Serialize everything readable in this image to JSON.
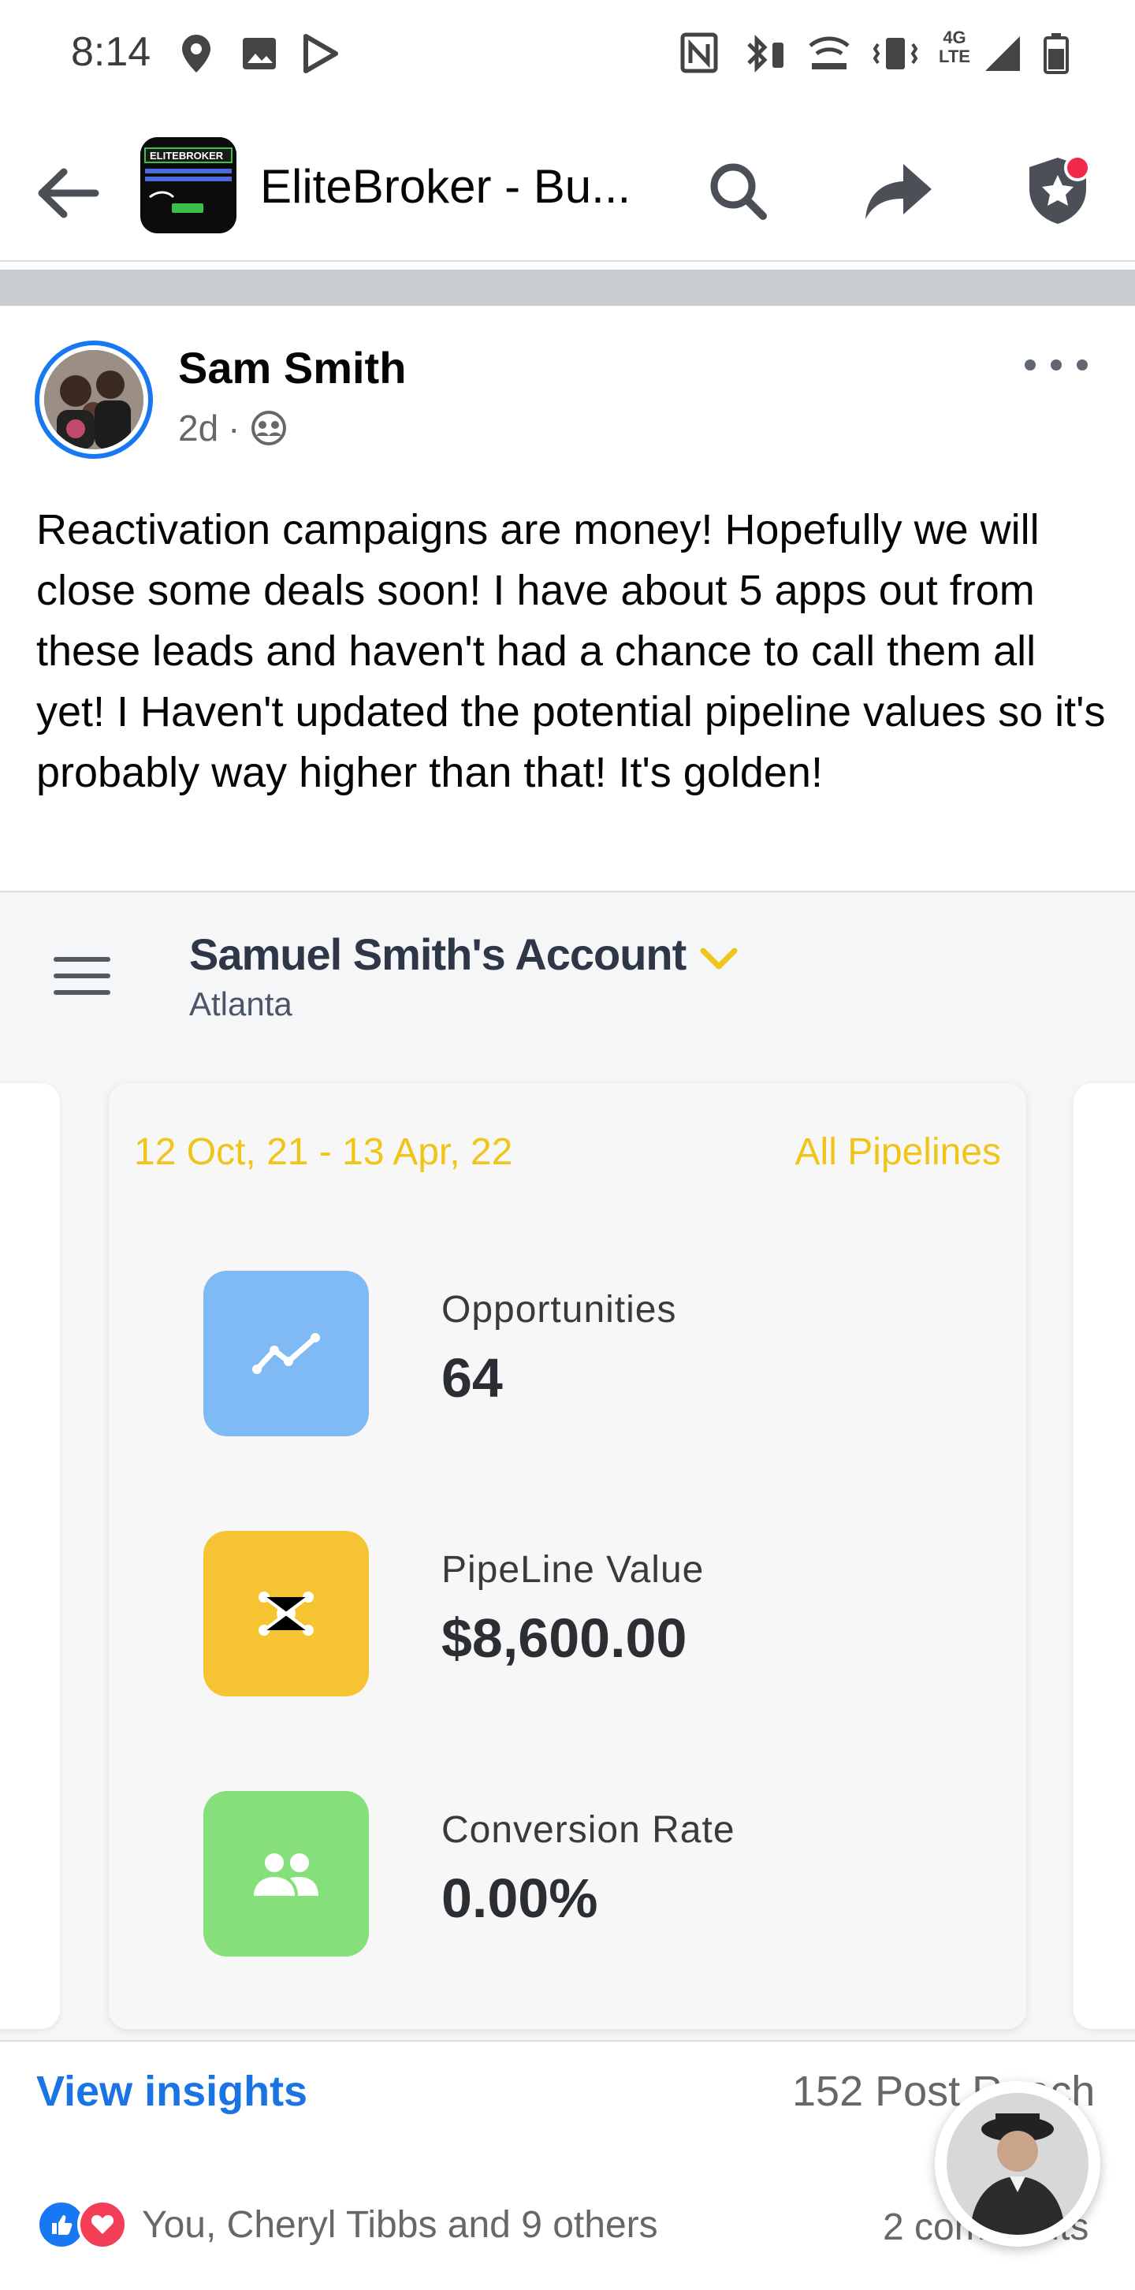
{
  "status_bar": {
    "time": "8:14",
    "icons": [
      "location-icon",
      "gallery-icon",
      "play-store-icon",
      "nfc-icon",
      "bluetooth-icon",
      "wifi-calling-icon",
      "vibrate-icon",
      "lte-icon",
      "signal-icon",
      "battery-icon"
    ],
    "network": "4G LTE"
  },
  "header": {
    "group_name": "EliteBroker - Bu...",
    "thumb_brand": "ELITEBROKER"
  },
  "post": {
    "author": "Sam Smith",
    "time": "2d",
    "audience_icon": "group-icon",
    "text": "Reactivation campaigns are money! Hopefully we will close some deals soon! I have about 5 apps out from these leads and haven't had a chance to call them all yet! I Haven't updated the potential pipeline values so it's probably way higher than that! It's golden!"
  },
  "screenshot": {
    "account_name": "Samuel Smith's Account",
    "location": "Atlanta",
    "date_range": "12 Oct, 21 - 13 Apr, 22",
    "pipeline_filter": "All Pipelines",
    "stats": [
      {
        "label": "Opportunities",
        "value": "64",
        "icon": "trend-line-icon",
        "color": "#7fbaf5"
      },
      {
        "label": "PipeLine Value",
        "value": "$8,600.00",
        "icon": "network-icon",
        "color": "#f6c432"
      },
      {
        "label": "Conversion Rate",
        "value": "0.00%",
        "icon": "people-icon",
        "color": "#85e07c"
      }
    ]
  },
  "footer": {
    "view_insights": "View insights",
    "post_reach": "152 Post Reach",
    "reactions_text": "You, Cheryl Tibbs and 9 others",
    "comments": "2 comments"
  },
  "colors": {
    "facebook_blue": "#1877f2",
    "accent_yellow": "#f0c419",
    "notification_red": "#f02849"
  }
}
